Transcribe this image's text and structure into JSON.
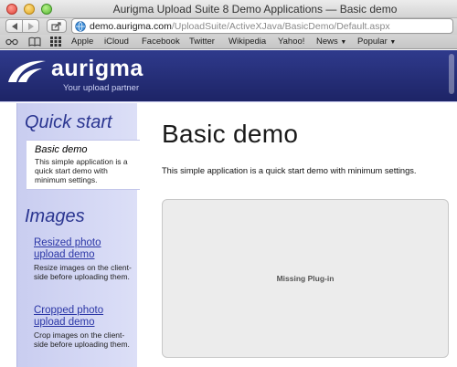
{
  "window": {
    "title": "Aurigma Upload Suite 8 Demo Applications — Basic demo"
  },
  "address_bar": {
    "domain": "demo.aurigma.com",
    "path": "/UploadSuite/ActiveXJava/BasicDemo/Default.aspx"
  },
  "bookmarks": [
    "Apple",
    "iCloud",
    "Facebook",
    "Twitter",
    "Wikipedia",
    "Yahoo!",
    "News",
    "Popular"
  ],
  "site": {
    "logo": "aurigma",
    "tagline": "Your upload partner",
    "brand_color": "#1d2466"
  },
  "sidebar": {
    "quick_start_heading": "Quick start",
    "active_item": {
      "title": "Basic demo",
      "description": "This simple application is a quick start demo with minimum settings."
    },
    "images_heading": "Images",
    "items": [
      {
        "label": "Resized photo upload demo",
        "description": "Resize images on the client-side before uploading them."
      },
      {
        "label": "Cropped photo upload demo",
        "description": "Crop images on the client-side before uploading them."
      }
    ]
  },
  "main": {
    "title": "Basic demo",
    "description": "This simple application is a quick start demo with minimum settings.",
    "plugin_placeholder": "Missing Plug-in"
  }
}
